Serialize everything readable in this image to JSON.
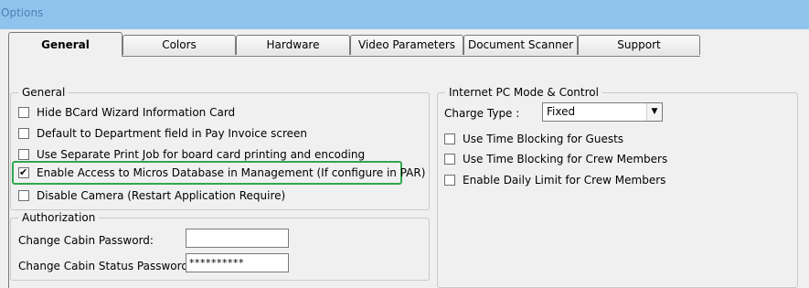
{
  "window": {
    "title": "Options"
  },
  "tabs": [
    {
      "label": "General",
      "active": true
    },
    {
      "label": "Colors",
      "active": false
    },
    {
      "label": "Hardware",
      "active": false
    },
    {
      "label": "Video Parameters",
      "active": false
    },
    {
      "label": "Document Scanner",
      "active": false
    },
    {
      "label": "Support",
      "active": false
    }
  ],
  "general_group": {
    "legend": "General",
    "items": [
      {
        "label": "Hide BCard Wizard Information Card",
        "checked": false
      },
      {
        "label": "Default to Department field in Pay Invoice screen",
        "checked": false
      },
      {
        "label": "Use Separate Print Job for board card printing and encoding",
        "checked": false
      },
      {
        "label": "Enable Access to Micros Database in Management (If configure in PAR)",
        "checked": true
      },
      {
        "label": "Disable Camera (Restart Application Require)",
        "checked": false
      }
    ],
    "check_mark": "✔"
  },
  "authorization_group": {
    "legend": "Authorization",
    "change_cabin_password_label": "Change Cabin Password:",
    "change_cabin_password_value": "",
    "change_cabin_status_password_label": "Change Cabin Status Password:",
    "change_cabin_status_password_value": "**********"
  },
  "internet_group": {
    "legend": "Internet PC Mode & Control",
    "charge_type_label": "Charge Type :",
    "charge_type_value": "Fixed",
    "dropdown_arrow": "▼",
    "items": [
      {
        "label": "Use Time Blocking for Guests",
        "checked": false
      },
      {
        "label": "Use Time Blocking for Crew Members",
        "checked": false
      },
      {
        "label": "Enable Daily Limit for Crew Members",
        "checked": false
      }
    ]
  },
  "colors": {
    "titlebar": "#8fc4ee",
    "highlight": "#2fa84f"
  }
}
